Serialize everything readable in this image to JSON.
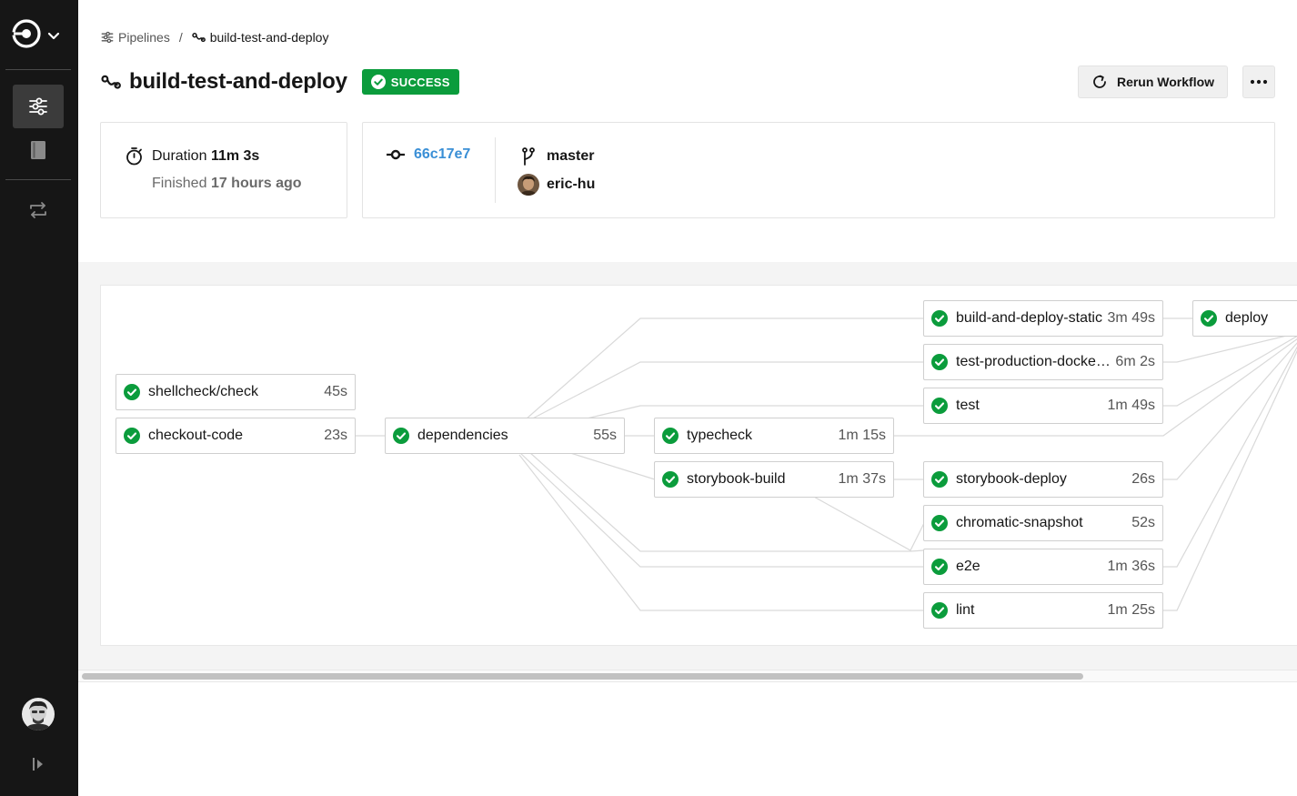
{
  "breadcrumb": {
    "pipelines_label": "Pipelines",
    "separator": "/",
    "workflow_label": "build-test-and-deploy"
  },
  "header": {
    "title": "build-test-and-deploy",
    "status": "SUCCESS",
    "rerun_label": "Rerun Workflow"
  },
  "summary": {
    "duration_label": "Duration",
    "duration_value": "11m 3s",
    "finished_label": "Finished",
    "finished_value": "17 hours ago",
    "commit": "66c17e7",
    "branch": "master",
    "author": "eric-hu"
  },
  "jobs": [
    {
      "name": "shellcheck/check",
      "duration": "45s"
    },
    {
      "name": "checkout-code",
      "duration": "23s"
    },
    {
      "name": "dependencies",
      "duration": "55s"
    },
    {
      "name": "typecheck",
      "duration": "1m 15s"
    },
    {
      "name": "storybook-build",
      "duration": "1m 37s"
    },
    {
      "name": "build-and-deploy-static",
      "duration": "3m 49s"
    },
    {
      "name": "test-production-docker…",
      "duration": "6m 2s"
    },
    {
      "name": "test",
      "duration": "1m 49s"
    },
    {
      "name": "storybook-deploy",
      "duration": "26s"
    },
    {
      "name": "chromatic-snapshot",
      "duration": "52s"
    },
    {
      "name": "e2e",
      "duration": "1m 36s"
    },
    {
      "name": "lint",
      "duration": "1m 25s"
    },
    {
      "name": "deploy",
      "duration": ""
    }
  ],
  "colors": {
    "success": "#0b9c3c",
    "sidebar": "#161616",
    "link": "#3a8fd6"
  },
  "icons": {
    "logo": "circleci-logo-icon",
    "pipelines": "pipelines-icon",
    "projects": "book-icon",
    "workflow": "workflow-icon",
    "success": "check-circle-icon"
  }
}
